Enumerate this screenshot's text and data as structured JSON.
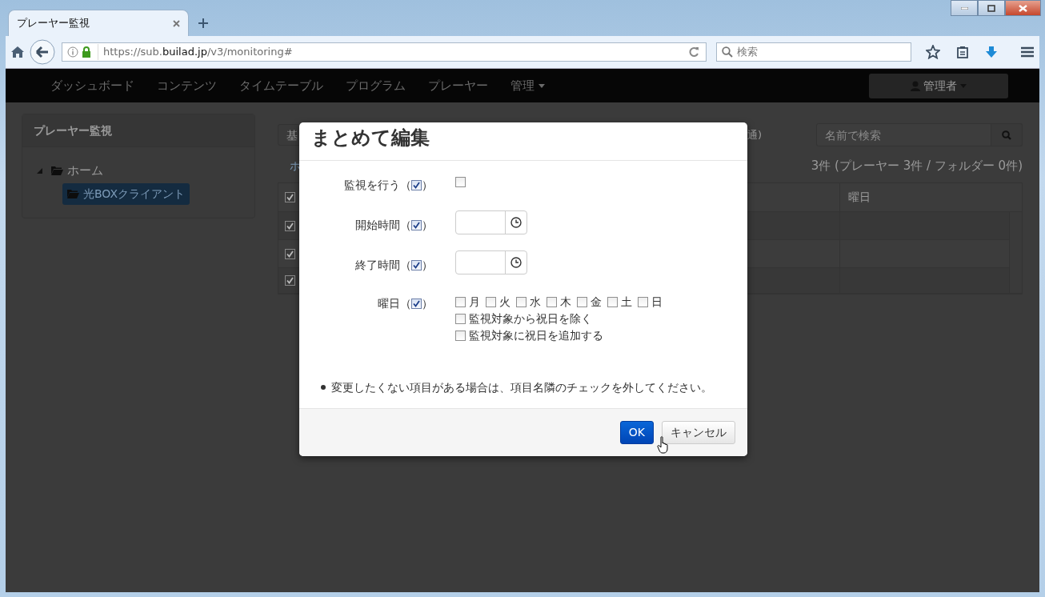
{
  "browser": {
    "tab_title": "プレーヤー監視",
    "url_scheme": "https://sub.",
    "url_domain": "builad.jp",
    "url_path": "/v3/monitoring#",
    "search_placeholder": "検索"
  },
  "navbar": {
    "items": [
      {
        "label": "ダッシュボード",
        "dropdown": false
      },
      {
        "label": "コンテンツ",
        "dropdown": false
      },
      {
        "label": "タイムテーブル",
        "dropdown": false
      },
      {
        "label": "プログラム",
        "dropdown": false
      },
      {
        "label": "プレーヤー",
        "dropdown": false
      },
      {
        "label": "管理",
        "dropdown": true
      }
    ],
    "user": "管理者"
  },
  "sidebar": {
    "title": "プレーヤー監視",
    "tree": [
      {
        "label": "ホーム",
        "expanded": true,
        "selected": false,
        "children": [
          {
            "label": "光BOXクライアント",
            "selected": true
          }
        ]
      }
    ]
  },
  "toolbar": {
    "button_fragment": "基",
    "text_fragment": "通)",
    "search_placeholder": "名前で検索"
  },
  "breadcrumb_fragment": "ホ",
  "count": "3件 (プレーヤー 3件 / フォルダー 0件)",
  "table": {
    "header_checked": true,
    "column_last": "曜日",
    "rows": [
      {
        "checked": true
      },
      {
        "checked": true
      },
      {
        "checked": true
      }
    ]
  },
  "modal": {
    "title": "まとめて編集",
    "fields": [
      {
        "kind": "checkbox",
        "label": "監視を行う（",
        "close": "）",
        "enabled": true,
        "checked": false
      },
      {
        "kind": "time",
        "label": "開始時間（",
        "close": "）",
        "enabled": true
      },
      {
        "kind": "time",
        "label": "終了時間（",
        "close": "）",
        "enabled": true
      },
      {
        "kind": "days",
        "label": "曜日（",
        "close": "）",
        "enabled": true,
        "days": [
          {
            "label": "月",
            "checked": false
          },
          {
            "label": "火",
            "checked": false
          },
          {
            "label": "水",
            "checked": false
          },
          {
            "label": "木",
            "checked": false
          },
          {
            "label": "金",
            "checked": false
          },
          {
            "label": "土",
            "checked": false
          },
          {
            "label": "日",
            "checked": false
          }
        ],
        "options": [
          {
            "label": "監視対象から祝日を除く",
            "checked": false
          },
          {
            "label": "監視対象に祝日を追加する",
            "checked": false
          }
        ]
      }
    ],
    "note": "変更したくない項目がある場合は、項目名隣のチェックを外してください。",
    "buttons": [
      {
        "label": "OK",
        "kind": "primary"
      },
      {
        "label": "キャンセル",
        "kind": "default"
      }
    ]
  }
}
